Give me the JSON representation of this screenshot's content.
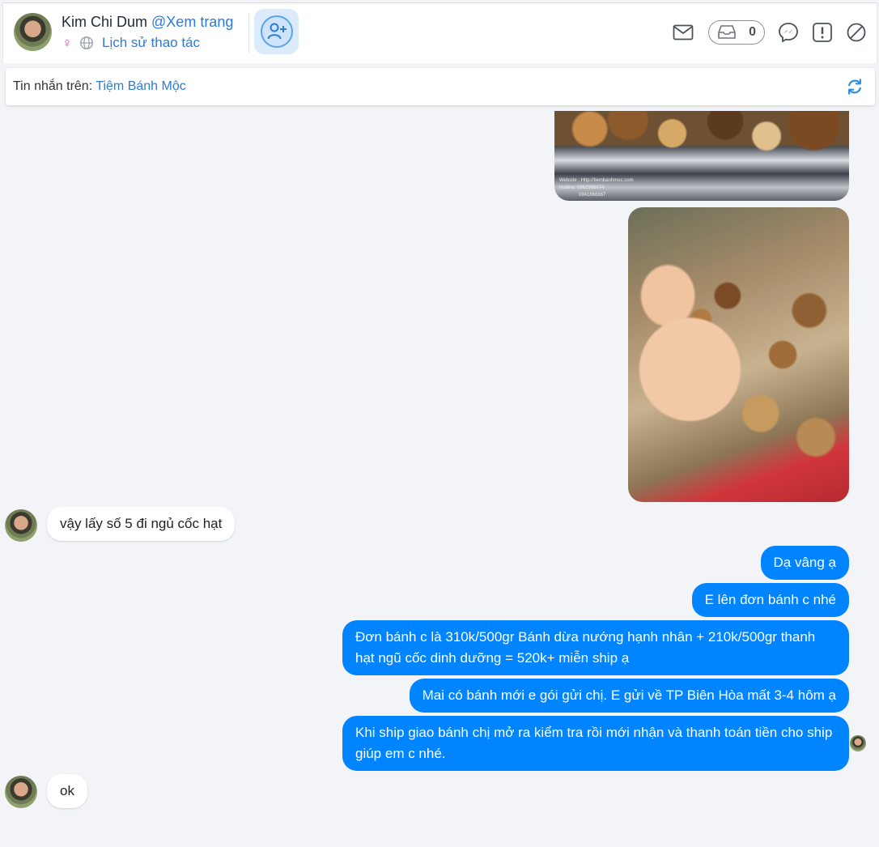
{
  "header": {
    "name": "Kim Chi Dum",
    "view_page": "@Xem trang",
    "gender_symbol": "♀",
    "history": "Lịch sử thao tác",
    "inbox_count": "0",
    "icons": [
      "mail-icon",
      "inbox-icon",
      "messenger-icon",
      "report-icon",
      "block-icon",
      "add-friend-icon",
      "globe-icon"
    ]
  },
  "source": {
    "label": "Tin nhắn trên: ",
    "page": "Tiệm Bánh Mộc"
  },
  "photo_watermark": {
    "l1": "Website : Http://tiembanhmoc.com",
    "l2": "Hotline: 0962988674",
    "l3": "0941866867"
  },
  "messages": [
    {
      "from": "customer",
      "text": "vậy lấy số 5 đi ngủ cốc hạt"
    },
    {
      "from": "page",
      "text": "Dạ vâng ạ"
    },
    {
      "from": "page",
      "text": "E lên đơn bánh c nhé"
    },
    {
      "from": "page",
      "text": "Đơn bánh c là 310k/500gr Bánh dừa nướng hạnh nhân + 210k/500gr thanh hạt ngũ cốc dinh dưỡng = 520k+ miễn ship ạ"
    },
    {
      "from": "page",
      "text": "Mai có bánh mới e gói gửi chị. E gửi về TP Biên Hòa mất 3-4 hôm ạ"
    },
    {
      "from": "page",
      "text": "Khi ship giao bánh chị mở ra kiểm tra rồi mới nhận và thanh toán tiền cho ship giúp em c nhé."
    },
    {
      "from": "customer",
      "text": "ok"
    }
  ],
  "colors": {
    "accent": "#2b7bd9",
    "outgoing_bubble": "#0084ff",
    "background": "#f2f4f7"
  }
}
